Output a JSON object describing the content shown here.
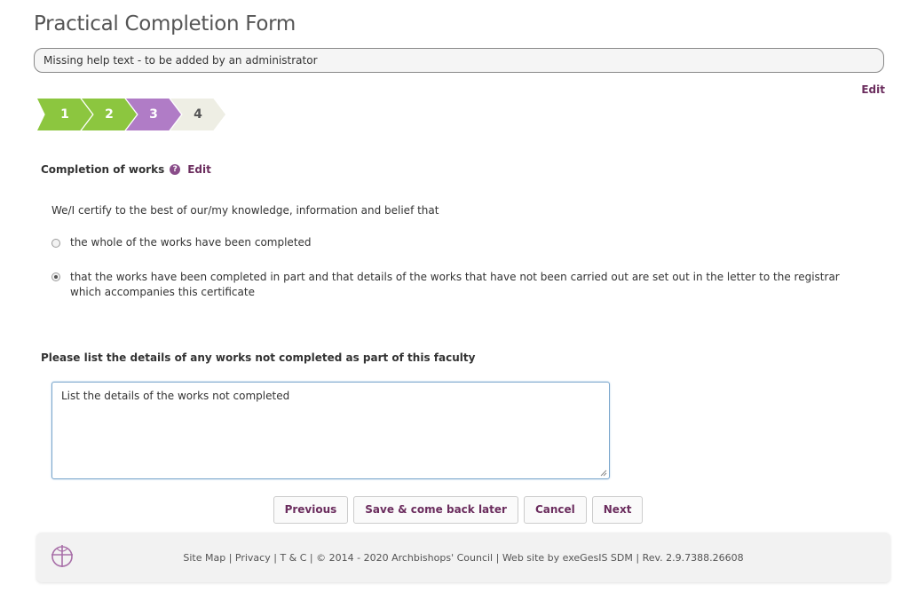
{
  "page": {
    "title": "Practical Completion Form",
    "help_text": "Missing help text - to be added by an administrator",
    "edit_label": "Edit"
  },
  "steps": [
    {
      "label": "1",
      "state": "completed",
      "color": "#8cc63f"
    },
    {
      "label": "2",
      "state": "completed",
      "color": "#8cc63f"
    },
    {
      "label": "3",
      "state": "current",
      "color": "#b07cc6"
    },
    {
      "label": "4",
      "state": "upcoming",
      "color": "#eeeee4"
    }
  ],
  "section": {
    "heading": "Completion of works",
    "help_icon": "question-icon",
    "edit_label": "Edit",
    "certify_text": "We/I certify to the best of our/my knowledge, information and belief that",
    "options": [
      {
        "label": "the whole of the works have been completed",
        "selected": false
      },
      {
        "label": "that the works have been completed in part and that details of the works that have not been carried out are set out in the letter to the registrar which accompanies this certificate",
        "selected": true
      }
    ]
  },
  "details": {
    "label": "Please list the details of any works not completed as part of this faculty",
    "value": "List the details of the works not completed"
  },
  "buttons": {
    "previous": "Previous",
    "save_later": "Save & come back later",
    "cancel": "Cancel",
    "next": "Next"
  },
  "footer": {
    "logo_icon": "church-of-england-logo",
    "site_map": "Site Map",
    "privacy": "Privacy",
    "tc": "T & C",
    "copyright": "© 2014 - 2020 Archbishops' Council",
    "website_by": "Web site by exeGesIS SDM",
    "revision": "Rev. 2.9.7388.26608"
  },
  "colors": {
    "accent": "#6b2d5e",
    "step_done": "#8cc63f",
    "step_current": "#b07cc6"
  }
}
